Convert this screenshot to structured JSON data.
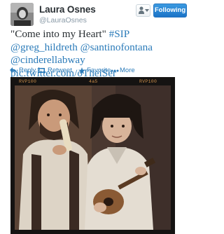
{
  "user": {
    "display_name": "Laura Osnes",
    "username": "@LauraOsnes"
  },
  "follow_button": {
    "label": "Following"
  },
  "tweet": {
    "quote": "\"Come into my Heart\"",
    "hashtag": "#SIP",
    "mentions": [
      "@greg_hildreth",
      "@santinofontana",
      "@cinderellabway"
    ],
    "link": "pic.twitter.com/oTheiSer"
  },
  "actions": {
    "reply": "Reply",
    "retweet": "Retweet",
    "favorite": "Favorite",
    "more": "More"
  },
  "photo": {
    "film_marks": {
      "left": "RVP100",
      "center": "4a5",
      "right": "RVP100"
    }
  },
  "colors": {
    "link": "#2b7bb9",
    "follow_button": "#2a85d2",
    "text": "#292f33",
    "muted": "#8899a6"
  }
}
